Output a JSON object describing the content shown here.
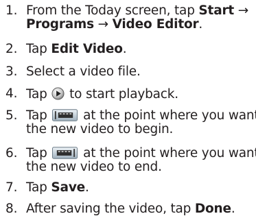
{
  "steps": [
    {
      "number": "1.",
      "line1_prefix": "From the Today screen, tap ",
      "line1_bold": "Start",
      "arrow1": "→",
      "line2_bold_a": "Programs",
      "arrow2": "→",
      "line2_bold_b": "Video Editor",
      "line2_suffix": "."
    },
    {
      "number": "2.",
      "prefix": "Tap ",
      "bold": "Edit Video",
      "suffix": "."
    },
    {
      "number": "3.",
      "text": "Select a video file."
    },
    {
      "number": "4.",
      "prefix": "Tap ",
      "icon": "play-icon",
      "suffix": " to start playback."
    },
    {
      "number": "5.",
      "prefix": "Tap ",
      "icon": "mark-start-icon",
      "suffix": " at the point where you want",
      "line2": "the new video to begin."
    },
    {
      "number": "6.",
      "prefix": "Tap ",
      "icon": "mark-end-icon",
      "suffix": " at the point where you want",
      "line2": "the new video to end."
    },
    {
      "number": "7.",
      "prefix": "Tap ",
      "bold": "Save",
      "suffix": "."
    },
    {
      "number": "8.",
      "prefix": "After saving the video, tap ",
      "bold": "Done",
      "suffix": "."
    }
  ]
}
